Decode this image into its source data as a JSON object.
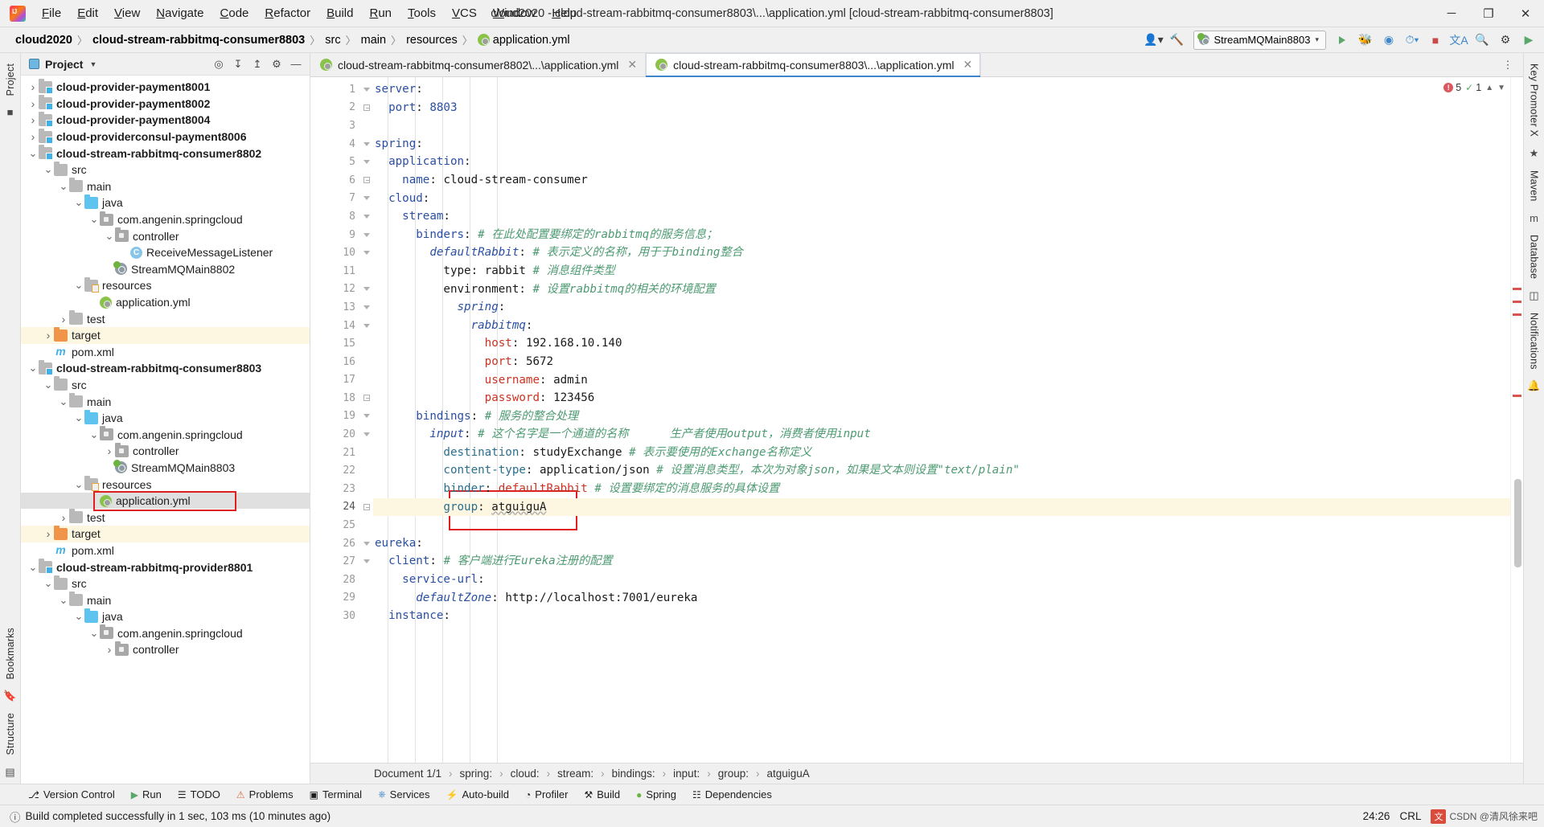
{
  "window": {
    "title": "cloud2020 - cloud-stream-rabbitmq-consumer8803\\...\\application.yml [cloud-stream-rabbitmq-consumer8803]",
    "minimize": "─",
    "maximize": "❐",
    "close": "✕"
  },
  "menu": [
    {
      "label": "File"
    },
    {
      "label": "Edit"
    },
    {
      "label": "View"
    },
    {
      "label": "Navigate"
    },
    {
      "label": "Code"
    },
    {
      "label": "Refactor"
    },
    {
      "label": "Build"
    },
    {
      "label": "Run"
    },
    {
      "label": "Tools"
    },
    {
      "label": "VCS"
    },
    {
      "label": "Window"
    },
    {
      "label": "Help"
    }
  ],
  "breadcrumb": {
    "items": [
      {
        "label": "cloud2020",
        "bold": true
      },
      {
        "label": "cloud-stream-rabbitmq-consumer8803",
        "bold": true
      },
      {
        "label": "src",
        "bold": false
      },
      {
        "label": "main",
        "bold": false
      },
      {
        "label": "resources",
        "bold": false
      },
      {
        "label": "application.yml",
        "bold": false,
        "icon": "yml-icon"
      }
    ],
    "separator": "〉"
  },
  "toolbar": {
    "run_config": "StreamMQMain8803",
    "search_icon": "search-icon",
    "settings_icon": "gear-icon",
    "build_icon": "hammer-icon",
    "user_icon": "user-icon",
    "translate_icon": "translate-icon",
    "run_icon": "run-icon",
    "debug_icon": "debug-icon",
    "coverage_icon": "coverage-icon",
    "profile_icon": "profile-icon",
    "stop_icon": "stop-icon",
    "more_icon": "more-icon"
  },
  "left_strip": [
    {
      "label": "Project",
      "name": "tool-window-project"
    },
    {
      "label": "",
      "name": "structure-strip-icon"
    }
  ],
  "left_strip_bottom": [
    {
      "label": "Bookmarks",
      "name": "tool-window-bookmarks"
    },
    {
      "label": "Structure",
      "name": "tool-window-structure"
    }
  ],
  "right_strip": [
    {
      "label": "Key Promoter X",
      "name": "tool-window-key-promoter"
    },
    {
      "label": "Maven",
      "name": "tool-window-maven"
    },
    {
      "label": "Database",
      "name": "tool-window-database"
    },
    {
      "label": "Notifications",
      "name": "tool-window-notifications"
    }
  ],
  "project_panel": {
    "title": "Project",
    "icons": [
      "locate-icon",
      "collapse-all-icon",
      "expand-all-icon",
      "gear-icon",
      "hide-icon"
    ],
    "tree": [
      {
        "depth": 1,
        "arrow": "right",
        "icon": "module",
        "label": "cloud-provider-payment8001",
        "bold": true
      },
      {
        "depth": 1,
        "arrow": "right",
        "icon": "module",
        "label": "cloud-provider-payment8002",
        "bold": true
      },
      {
        "depth": 1,
        "arrow": "right",
        "icon": "module",
        "label": "cloud-provider-payment8004",
        "bold": true
      },
      {
        "depth": 1,
        "arrow": "right",
        "icon": "module",
        "label": "cloud-providerconsul-payment8006",
        "bold": true
      },
      {
        "depth": 1,
        "arrow": "down",
        "icon": "module",
        "label": "cloud-stream-rabbitmq-consumer8802",
        "bold": true
      },
      {
        "depth": 2,
        "arrow": "down",
        "icon": "folder",
        "label": "src",
        "bold": false
      },
      {
        "depth": 3,
        "arrow": "down",
        "icon": "folder",
        "label": "main",
        "bold": false
      },
      {
        "depth": 4,
        "arrow": "down",
        "icon": "source",
        "label": "java",
        "bold": false
      },
      {
        "depth": 5,
        "arrow": "down",
        "icon": "package",
        "label": "com.angenin.springcloud",
        "bold": false
      },
      {
        "depth": 6,
        "arrow": "down",
        "icon": "package",
        "label": "controller",
        "bold": false
      },
      {
        "depth": 7,
        "arrow": "none",
        "icon": "class",
        "label": "ReceiveMessageListener",
        "bold": false
      },
      {
        "depth": 6,
        "arrow": "none",
        "icon": "boot",
        "label": "StreamMQMain8802",
        "bold": false
      },
      {
        "depth": 4,
        "arrow": "down",
        "icon": "resource",
        "label": "resources",
        "bold": false
      },
      {
        "depth": 5,
        "arrow": "none",
        "icon": "yml",
        "label": "application.yml",
        "bold": false
      },
      {
        "depth": 3,
        "arrow": "right",
        "icon": "folder",
        "label": "test",
        "bold": false
      },
      {
        "depth": 2,
        "arrow": "right",
        "icon": "target",
        "label": "target",
        "bold": false,
        "highlight": "yellow"
      },
      {
        "depth": 2,
        "arrow": "none",
        "icon": "maven",
        "label": "pom.xml",
        "bold": false
      },
      {
        "depth": 1,
        "arrow": "down",
        "icon": "module",
        "label": "cloud-stream-rabbitmq-consumer8803",
        "bold": true
      },
      {
        "depth": 2,
        "arrow": "down",
        "icon": "folder",
        "label": "src",
        "bold": false
      },
      {
        "depth": 3,
        "arrow": "down",
        "icon": "folder",
        "label": "main",
        "bold": false
      },
      {
        "depth": 4,
        "arrow": "down",
        "icon": "source",
        "label": "java",
        "bold": false
      },
      {
        "depth": 5,
        "arrow": "down",
        "icon": "package",
        "label": "com.angenin.springcloud",
        "bold": false
      },
      {
        "depth": 6,
        "arrow": "right",
        "icon": "package",
        "label": "controller",
        "bold": false
      },
      {
        "depth": 6,
        "arrow": "none",
        "icon": "boot",
        "label": "StreamMQMain8803",
        "bold": false
      },
      {
        "depth": 4,
        "arrow": "down",
        "icon": "resource",
        "label": "resources",
        "bold": false
      },
      {
        "depth": 5,
        "arrow": "none",
        "icon": "yml",
        "label": "application.yml",
        "bold": false,
        "highlight": "gray",
        "redbox": true
      },
      {
        "depth": 3,
        "arrow": "right",
        "icon": "folder",
        "label": "test",
        "bold": false
      },
      {
        "depth": 2,
        "arrow": "right",
        "icon": "target",
        "label": "target",
        "bold": false,
        "highlight": "yellow"
      },
      {
        "depth": 2,
        "arrow": "none",
        "icon": "maven",
        "label": "pom.xml",
        "bold": false
      },
      {
        "depth": 1,
        "arrow": "down",
        "icon": "module",
        "label": "cloud-stream-rabbitmq-provider8801",
        "bold": true
      },
      {
        "depth": 2,
        "arrow": "down",
        "icon": "folder",
        "label": "src",
        "bold": false
      },
      {
        "depth": 3,
        "arrow": "down",
        "icon": "folder",
        "label": "main",
        "bold": false
      },
      {
        "depth": 4,
        "arrow": "down",
        "icon": "source",
        "label": "java",
        "bold": false
      },
      {
        "depth": 5,
        "arrow": "down",
        "icon": "package",
        "label": "com.angenin.springcloud",
        "bold": false
      },
      {
        "depth": 6,
        "arrow": "right",
        "icon": "package",
        "label": "controller",
        "bold": false
      }
    ]
  },
  "editor": {
    "tabs": [
      {
        "label": "cloud-stream-rabbitmq-consumer8802\\...\\application.yml",
        "active": false,
        "icon": "yml-icon"
      },
      {
        "label": "cloud-stream-rabbitmq-consumer8803\\...\\application.yml",
        "active": true,
        "icon": "yml-icon"
      }
    ],
    "inspection": {
      "error_count": "5",
      "warning_count": "1"
    },
    "lines": [
      {
        "n": "1",
        "tokens": [
          {
            "t": "server",
            "c": "key"
          },
          {
            "t": ":",
            "c": "p"
          }
        ]
      },
      {
        "n": "2",
        "tokens": [
          {
            "t": "  port",
            "c": "key"
          },
          {
            "t": ": ",
            "c": "p"
          },
          {
            "t": "8803",
            "c": "num"
          }
        ]
      },
      {
        "n": "3",
        "tokens": []
      },
      {
        "n": "4",
        "tokens": [
          {
            "t": "spring",
            "c": "key"
          },
          {
            "t": ":",
            "c": "p"
          }
        ]
      },
      {
        "n": "5",
        "tokens": [
          {
            "t": "  application",
            "c": "key"
          },
          {
            "t": ":",
            "c": "p"
          }
        ]
      },
      {
        "n": "6",
        "tokens": [
          {
            "t": "    name",
            "c": "key"
          },
          {
            "t": ": ",
            "c": "p"
          },
          {
            "t": "cloud-stream-consumer",
            "c": "val"
          }
        ]
      },
      {
        "n": "7",
        "tokens": [
          {
            "t": "  cloud",
            "c": "key"
          },
          {
            "t": ":",
            "c": "p"
          }
        ]
      },
      {
        "n": "8",
        "tokens": [
          {
            "t": "    stream",
            "c": "key"
          },
          {
            "t": ":",
            "c": "p"
          }
        ]
      },
      {
        "n": "9",
        "tokens": [
          {
            "t": "      binders",
            "c": "key"
          },
          {
            "t": ": ",
            "c": "p"
          },
          {
            "t": "# 在此处配置要绑定的rabbitmq的服务信息；",
            "c": "cmt"
          }
        ]
      },
      {
        "n": "10",
        "tokens": [
          {
            "t": "        defaultRabbit",
            "c": "keyi"
          },
          {
            "t": ": ",
            "c": "p"
          },
          {
            "t": "# 表示定义的名称，用于于binding整合",
            "c": "cmt"
          }
        ]
      },
      {
        "n": "11",
        "tokens": [
          {
            "t": "          type",
            "c": "key2"
          },
          {
            "t": ": ",
            "c": "p"
          },
          {
            "t": "rabbit ",
            "c": "val"
          },
          {
            "t": "# 消息组件类型",
            "c": "cmt"
          }
        ]
      },
      {
        "n": "12",
        "tokens": [
          {
            "t": "          environment",
            "c": "key2"
          },
          {
            "t": ": ",
            "c": "p"
          },
          {
            "t": "# 设置rabbitmq的相关的环境配置",
            "c": "cmt"
          }
        ]
      },
      {
        "n": "13",
        "tokens": [
          {
            "t": "            spring",
            "c": "keyi"
          },
          {
            "t": ":",
            "c": "p"
          }
        ]
      },
      {
        "n": "14",
        "tokens": [
          {
            "t": "              rabbitmq",
            "c": "keyi"
          },
          {
            "t": ":",
            "c": "p"
          }
        ]
      },
      {
        "n": "15",
        "tokens": [
          {
            "t": "                host",
            "c": "red"
          },
          {
            "t": ": ",
            "c": "p"
          },
          {
            "t": "192.168.10.140",
            "c": "val"
          }
        ]
      },
      {
        "n": "16",
        "tokens": [
          {
            "t": "                port",
            "c": "red"
          },
          {
            "t": ": ",
            "c": "p"
          },
          {
            "t": "5672",
            "c": "val"
          }
        ]
      },
      {
        "n": "17",
        "tokens": [
          {
            "t": "                username",
            "c": "red"
          },
          {
            "t": ": ",
            "c": "p"
          },
          {
            "t": "admin",
            "c": "val"
          }
        ]
      },
      {
        "n": "18",
        "tokens": [
          {
            "t": "                password",
            "c": "red"
          },
          {
            "t": ": ",
            "c": "p"
          },
          {
            "t": "123456",
            "c": "val"
          }
        ]
      },
      {
        "n": "19",
        "tokens": [
          {
            "t": "      bindings",
            "c": "key"
          },
          {
            "t": ": ",
            "c": "p"
          },
          {
            "t": "# 服务的整合处理",
            "c": "cmt"
          }
        ]
      },
      {
        "n": "20",
        "tokens": [
          {
            "t": "        input",
            "c": "keyi"
          },
          {
            "t": ": ",
            "c": "p"
          },
          {
            "t": "# 这个名字是一个通道的名称      生产者使用output，消费者使用input",
            "c": "cmt"
          }
        ]
      },
      {
        "n": "21",
        "tokens": [
          {
            "t": "          destination",
            "c": "teal"
          },
          {
            "t": ": ",
            "c": "p"
          },
          {
            "t": "studyExchange ",
            "c": "val"
          },
          {
            "t": "# 表示要使用的Exchange名称定义",
            "c": "cmt"
          }
        ]
      },
      {
        "n": "22",
        "tokens": [
          {
            "t": "          content-type",
            "c": "teal"
          },
          {
            "t": ": ",
            "c": "p"
          },
          {
            "t": "application/json ",
            "c": "val"
          },
          {
            "t": "# 设置消息类型，本次为对象json，如果是文本则设置\"text/plain\"",
            "c": "cmt"
          }
        ]
      },
      {
        "n": "23",
        "tokens": [
          {
            "t": "          binder",
            "c": "teal"
          },
          {
            "t": ": ",
            "c": "p"
          },
          {
            "t": "defaultRabbit ",
            "c": "red"
          },
          {
            "t": "# 设置要绑定的消息服务的具体设置",
            "c": "cmt"
          }
        ]
      },
      {
        "n": "24",
        "tokens": [
          {
            "t": "          group",
            "c": "teal"
          },
          {
            "t": ": ",
            "c": "p"
          },
          {
            "t": "atguiguA",
            "c": "val-sq"
          }
        ],
        "highlight": true
      },
      {
        "n": "25",
        "tokens": []
      },
      {
        "n": "26",
        "tokens": [
          {
            "t": "eureka",
            "c": "key"
          },
          {
            "t": ":",
            "c": "p"
          }
        ]
      },
      {
        "n": "27",
        "tokens": [
          {
            "t": "  client",
            "c": "key"
          },
          {
            "t": ": ",
            "c": "p"
          },
          {
            "t": "# 客户端进行Eureka注册的配置",
            "c": "cmt"
          }
        ]
      },
      {
        "n": "28",
        "tokens": [
          {
            "t": "    service-url",
            "c": "key"
          },
          {
            "t": ":",
            "c": "p"
          }
        ]
      },
      {
        "n": "29",
        "tokens": [
          {
            "t": "      defaultZone",
            "c": "keyi"
          },
          {
            "t": ": ",
            "c": "p"
          },
          {
            "t": "http://localhost:7001/eureka",
            "c": "val"
          }
        ]
      },
      {
        "n": "30",
        "tokens": [
          {
            "t": "  instance",
            "c": "key"
          },
          {
            "t": ":",
            "c": "p"
          }
        ]
      }
    ]
  },
  "doc_crumb": {
    "label": "Document 1/1",
    "path": [
      "spring:",
      "cloud:",
      "stream:",
      "bindings:",
      "input:",
      "group:",
      "atguiguA"
    ]
  },
  "bottom_tools": [
    {
      "label": "Version Control",
      "icon": "branch-icon"
    },
    {
      "label": "Run",
      "icon": "play-icon"
    },
    {
      "label": "TODO",
      "icon": "todo-icon"
    },
    {
      "label": "Problems",
      "icon": "problems-icon"
    },
    {
      "label": "Terminal",
      "icon": "terminal-icon"
    },
    {
      "label": "Services",
      "icon": "services-icon"
    },
    {
      "label": "Auto-build",
      "icon": "autobuild-icon"
    },
    {
      "label": "Profiler",
      "icon": "profiler-icon"
    },
    {
      "label": "Build",
      "icon": "build-icon"
    },
    {
      "label": "Spring",
      "icon": "spring-icon"
    },
    {
      "label": "Dependencies",
      "icon": "dependencies-icon"
    }
  ],
  "status_bar": {
    "message": "Build completed successfully in 1 sec, 103 ms (10 minutes ago)",
    "caret": "24:26",
    "line_sep": "CRL",
    "watermark": "CSDN @清风徐来吧"
  },
  "colors": {
    "accent": "#3d86c9",
    "error": "#e02020",
    "comment": "#4d9a72",
    "key": "#2a4fa3",
    "red_key": "#cc3322"
  }
}
